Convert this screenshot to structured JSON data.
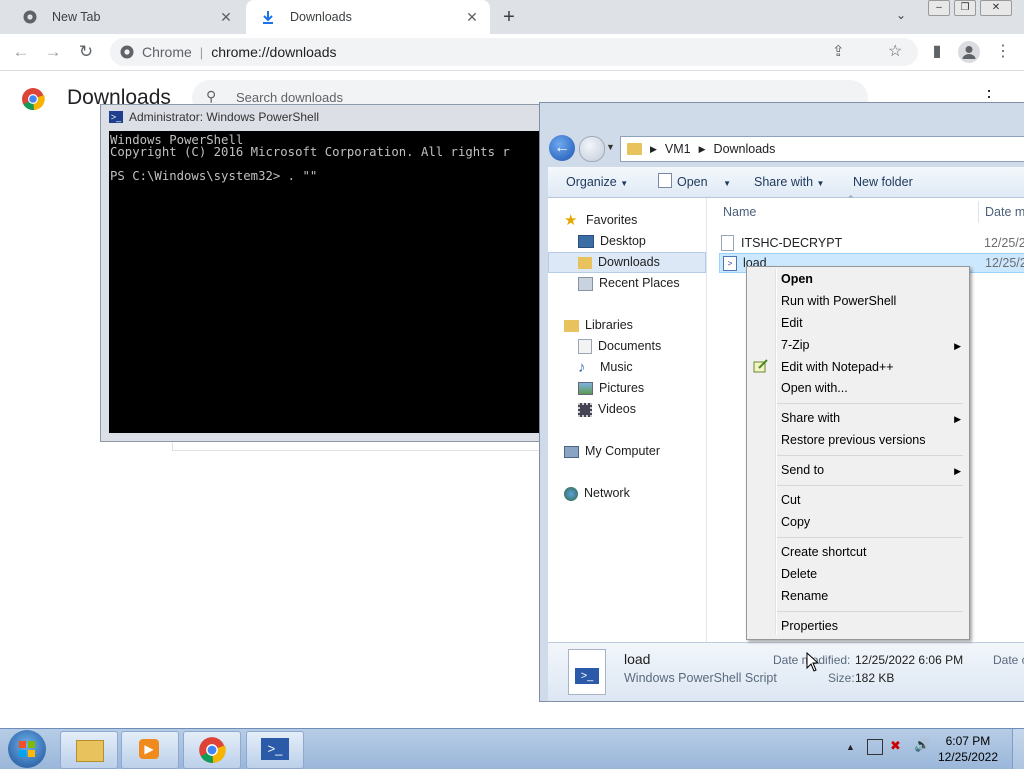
{
  "chrome": {
    "tabs": [
      {
        "title": "New Tab"
      },
      {
        "title": "Downloads"
      }
    ],
    "omnibox": {
      "site": "Chrome",
      "url": "chrome://downloads"
    },
    "page": {
      "title": "Downloads",
      "search_placeholder": "Search downloads"
    }
  },
  "powershell": {
    "title": "Administrator: Windows PowerShell",
    "lines": [
      "Windows PowerShell",
      "Copyright (C) 2016 Microsoft Corporation. All rights r",
      "",
      "PS C:\\Windows\\system32> . \"\""
    ]
  },
  "explorer": {
    "breadcrumb": [
      "VM1",
      "Downloads"
    ],
    "commands": [
      "Organize",
      "Open",
      "Share with",
      "New folder"
    ],
    "columns": {
      "name": "Name",
      "date": "Date m"
    },
    "nav": {
      "favorites": "Favorites",
      "desktop": "Desktop",
      "downloads": "Downloads",
      "recent": "Recent Places",
      "libraries": "Libraries",
      "documents": "Documents",
      "music": "Music",
      "pictures": "Pictures",
      "videos": "Videos",
      "computer": "My Computer",
      "network": "Network"
    },
    "files": [
      {
        "name": "ITSHC-DECRYPT",
        "date": "12/25/2"
      },
      {
        "name": "load",
        "date": "12/25/2"
      }
    ],
    "details": {
      "name": "load",
      "type": "Windows PowerShell Script",
      "modified_label": "Date modified:",
      "modified": "12/25/2022 6:06 PM",
      "size_label": "Size:",
      "size": "182 KB",
      "extra": "Date c"
    }
  },
  "context_menu": {
    "open": "Open",
    "run_ps": "Run with PowerShell",
    "edit": "Edit",
    "zip": "7-Zip",
    "notepad": "Edit with Notepad++",
    "open_with": "Open with...",
    "share_with": "Share with",
    "restore": "Restore previous versions",
    "send_to": "Send to",
    "cut": "Cut",
    "copy": "Copy",
    "create_shortcut": "Create shortcut",
    "delete": "Delete",
    "rename": "Rename",
    "properties": "Properties"
  },
  "taskbar": {
    "time": "6:07 PM",
    "date": "12/25/2022"
  },
  "colors": {
    "chrome_tab_strip": "#dee1e6",
    "ps_background": "#000000",
    "explorer_frame": "#cfdbe8",
    "selection": "#cce8ff"
  }
}
